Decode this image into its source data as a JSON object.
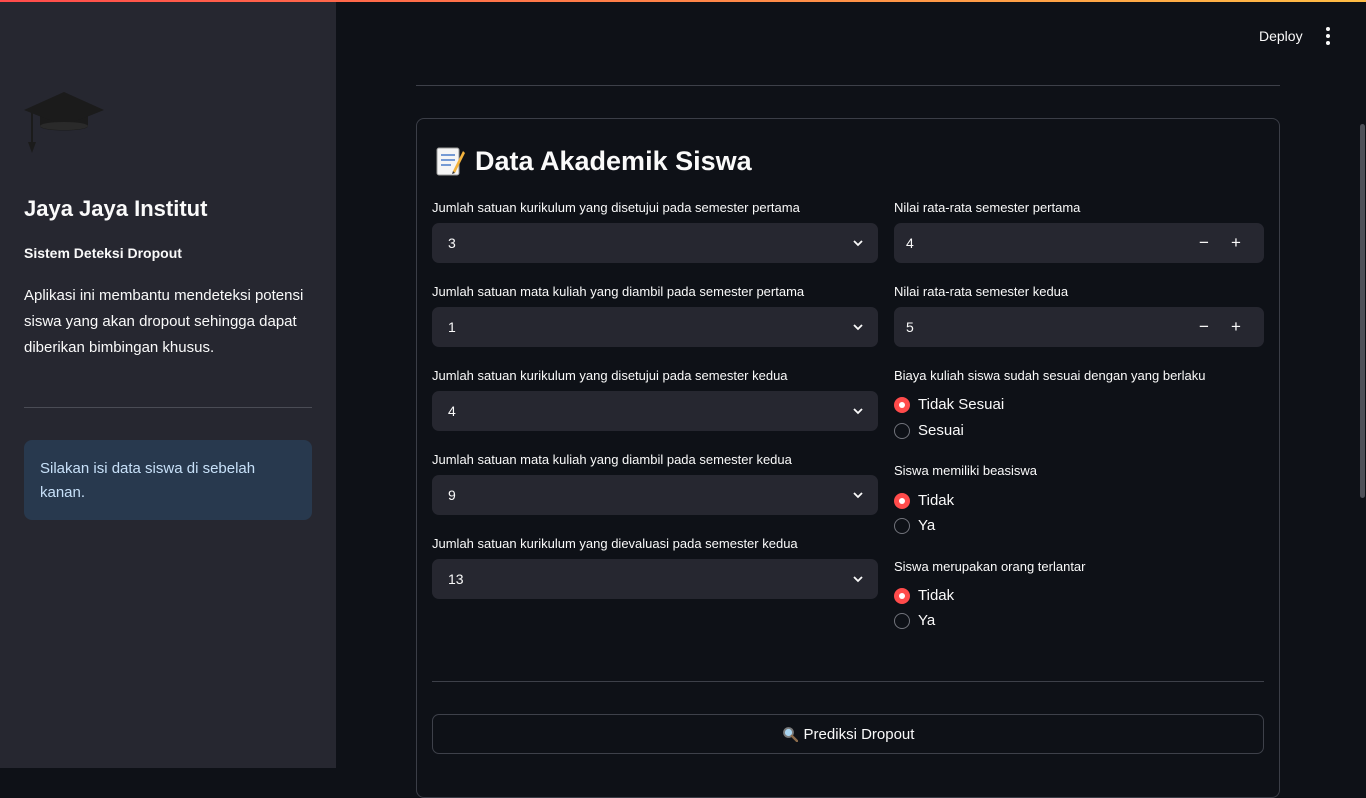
{
  "sidebar": {
    "title": "Jaya Jaya Institut",
    "subtitle": "Sistem Deteksi Dropout",
    "description": "Aplikasi ini membantu mendeteksi potensi siswa yang akan dropout sehingga dapat diberikan bimbingan khusus.",
    "info": "Silakan isi data siswa di sebelah kanan.",
    "logo_icon": "graduation-cap-icon"
  },
  "header": {
    "deploy_label": "Deploy",
    "menu_icon": "vertical-ellipsis-icon"
  },
  "form": {
    "heading": "Data Akademik Siswa",
    "heading_icon": "memo-icon",
    "left_fields": [
      {
        "label": "Jumlah satuan kurikulum yang disetujui pada semester pertama",
        "value": "3"
      },
      {
        "label": "Jumlah satuan mata kuliah yang diambil pada semester pertama",
        "value": "1"
      },
      {
        "label": "Jumlah satuan kurikulum yang disetujui pada semester kedua",
        "value": "4"
      },
      {
        "label": "Jumlah satuan mata kuliah yang diambil pada semester kedua",
        "value": "9"
      },
      {
        "label": "Jumlah satuan kurikulum yang dievaluasi pada semester kedua",
        "value": "13"
      }
    ],
    "number_fields": [
      {
        "label": "Nilai rata-rata semester pertama",
        "value": "4",
        "minus": "−",
        "plus": "+"
      },
      {
        "label": "Nilai rata-rata semester kedua",
        "value": "5",
        "minus": "−",
        "plus": "+"
      }
    ],
    "radio_groups": [
      {
        "label": "Biaya kuliah siswa sudah sesuai dengan yang berlaku",
        "options": [
          "Tidak Sesuai",
          "Sesuai"
        ],
        "selected": 0
      },
      {
        "label": "Siswa memiliki beasiswa",
        "options": [
          "Tidak",
          "Ya"
        ],
        "selected": 0
      },
      {
        "label": "Siswa merupakan orang terlantar",
        "options": [
          "Tidak",
          "Ya"
        ],
        "selected": 0
      }
    ],
    "submit_label": "Prediksi Dropout",
    "submit_icon": "magnifying-glass-icon"
  },
  "colors": {
    "accent": "#ff4b4b",
    "background": "#0e1117",
    "sidebar": "#262730",
    "info_bg": "#28394e"
  }
}
